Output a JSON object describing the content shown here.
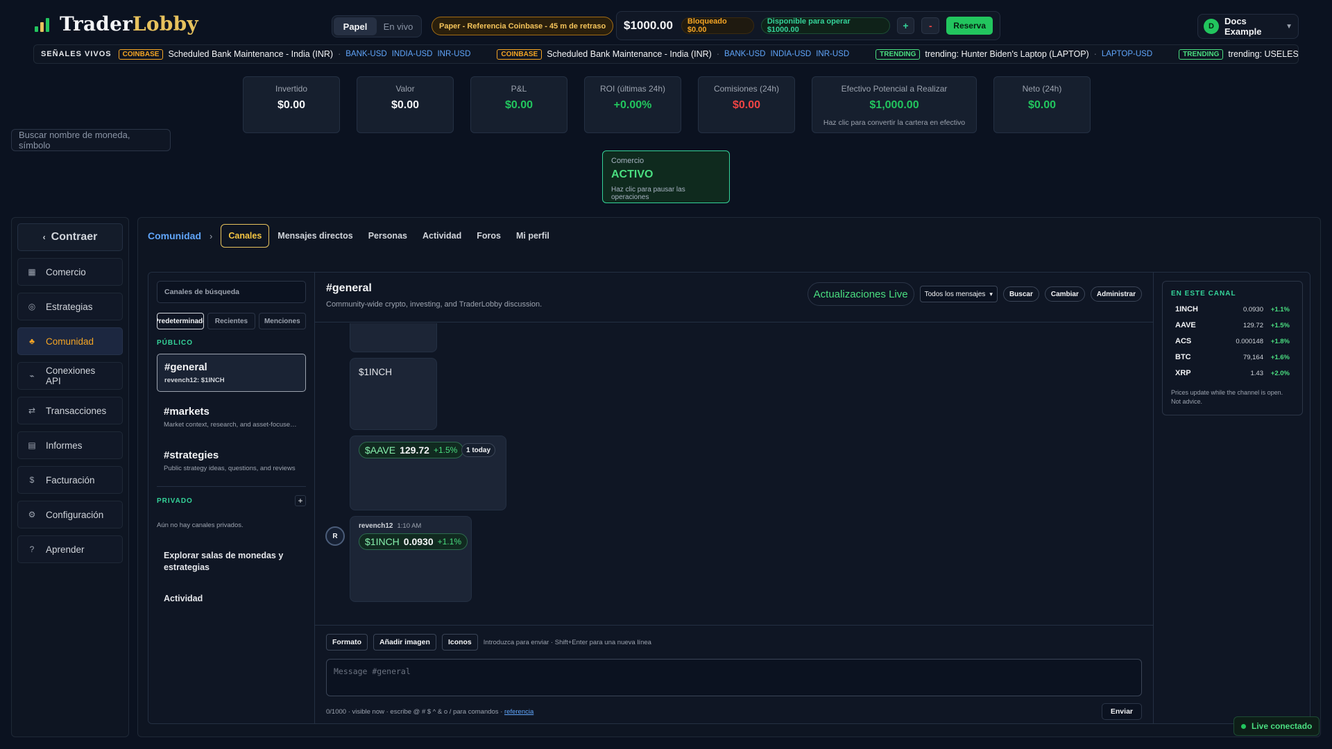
{
  "header": {
    "logo_part1": "Trader",
    "logo_part2": "Lobby",
    "mode_paper": "Papel",
    "mode_live": "En vivo",
    "paper_notice": "Paper - Referencia Coinbase - 45 m de retraso",
    "balance": "$1000.00",
    "locked": "Bloqueado $0.00",
    "available": "Disponible para operar $1000.00",
    "plus_label": "+",
    "minus_label": "-",
    "reserve_label": "Reserva",
    "user_initial": "D",
    "user_name": "Docs Example"
  },
  "ticker": {
    "title": "SEÑALES VIVOS",
    "items": [
      {
        "source": "COINBASE",
        "text": "Scheduled Bank Maintenance - India (INR)",
        "symbols": [
          "BANK-USD",
          "INDIA-USD",
          "INR-USD"
        ]
      },
      {
        "source": "COINBASE",
        "text": "Scheduled Bank Maintenance - India (INR)",
        "symbols": [
          "BANK-USD",
          "INDIA-USD",
          "INR-USD"
        ]
      },
      {
        "source": "TRENDING",
        "text": "trending: Hunter Biden's Laptop (LAPTOP)",
        "symbols": [
          "LAPTOP-USD"
        ]
      },
      {
        "source": "TRENDING",
        "text": "trending: USELESS STONK (STON",
        "symbols": []
      }
    ]
  },
  "stats": [
    {
      "label": "Invertido",
      "value": "$0.00",
      "color": "#f3f4f6"
    },
    {
      "label": "Valor",
      "value": "$0.00",
      "color": "#f3f4f6"
    },
    {
      "label": "P&L",
      "value": "$0.00",
      "color": "#22c55e"
    },
    {
      "label": "ROI (últimas 24h)",
      "value": "+0.00%",
      "color": "#22c55e"
    },
    {
      "label": "Comisiones (24h)",
      "value": "$0.00",
      "color": "#ef4444"
    },
    {
      "label": "Efectivo Potencial a Realizar",
      "value": "$1,000.00",
      "color": "#22c55e",
      "sub": "Haz clic para convertir la cartera en efectivo"
    },
    {
      "label": "Neto (24h)",
      "value": "$0.00",
      "color": "#22c55e"
    }
  ],
  "coin_search": {
    "placeholder": "Buscar nombre de moneda, símbolo"
  },
  "trading": {
    "label": "Comercio",
    "status": "ACTIVO",
    "sub": "Haz clic para pausar las operaciones"
  },
  "sidebar": {
    "collapse_label": "Contraer",
    "items": [
      {
        "label": "Comercio",
        "icon": "grid-icon",
        "glyph": "▦"
      },
      {
        "label": "Estrategias",
        "icon": "target-icon",
        "glyph": "◎"
      },
      {
        "label": "Comunidad",
        "icon": "community-icon",
        "glyph": "♣",
        "active": true
      },
      {
        "label": "Conexiones API",
        "icon": "link-icon",
        "glyph": "⌁"
      },
      {
        "label": "Transacciones",
        "icon": "swap-icon",
        "glyph": "⇄"
      },
      {
        "label": "Informes",
        "icon": "report-icon",
        "glyph": "▤"
      },
      {
        "label": "Facturación",
        "icon": "dollar-icon",
        "glyph": "$"
      },
      {
        "label": "Configuración",
        "icon": "gear-icon",
        "glyph": "⚙"
      },
      {
        "label": "Aprender",
        "icon": "help-icon",
        "glyph": "?"
      }
    ]
  },
  "community": {
    "crumb": "Comunidad",
    "tabs": [
      {
        "label": "Canales",
        "active": true
      },
      {
        "label": "Mensajes directos"
      },
      {
        "label": "Personas"
      },
      {
        "label": "Actividad"
      },
      {
        "label": "Foros"
      },
      {
        "label": "Mi perfil"
      }
    ]
  },
  "channels": {
    "search_placeholder": "Canales de búsqueda",
    "filter_tabs": [
      "Predeterminado",
      "Recientes",
      "Menciones"
    ],
    "public_label": "PÚBLICO",
    "public": [
      {
        "name": "#general",
        "desc": "revench12: $1INCH",
        "active": true
      },
      {
        "name": "#markets",
        "desc": "Market context, research, and asset-focused discussion"
      },
      {
        "name": "#strategies",
        "desc": "Public strategy ideas, questions, and reviews"
      }
    ],
    "private_label": "PRIVADO",
    "add_label": "+",
    "private_empty": "Aún no hay canales privados.",
    "explore_label": "Explorar salas de monedas y estrategias",
    "activity_label": "Actividad"
  },
  "chat": {
    "title": "#general",
    "desc": "Community-wide crypto, investing, and TraderLobby discussion.",
    "live_updates": "Actualizaciones Live",
    "filter_value": "Todos los mensajes",
    "search_label": "Buscar",
    "switch_label": "Cambiar",
    "admin_label": "Administrar",
    "messages": {
      "text_msg": "$1INCH",
      "aave": {
        "sym": "$AAVE",
        "price": "129.72",
        "chg": "+1.5%",
        "badge": "1 today"
      },
      "last": {
        "avatar": "R",
        "author": "revench12",
        "time": "1:10 AM",
        "sym": "$1INCH",
        "price": "0.0930",
        "chg": "+1.1%"
      }
    }
  },
  "composer": {
    "format_label": "Formato",
    "image_label": "Añadir imagen",
    "icons_label": "Iconos",
    "hint": "Introduzca para enviar · Shift+Enter para una nueva línea",
    "placeholder": "Message #general",
    "footer": "0/1000 · visible now · escribe @ # $ ^ & o / para comandos ·",
    "footer_link": "referencia",
    "send_label": "Enviar"
  },
  "in_channel": {
    "title": "EN ESTE CANAL",
    "rows": [
      {
        "sym": "1INCH",
        "price": "0.0930",
        "chg": "+1.1%"
      },
      {
        "sym": "AAVE",
        "price": "129.72",
        "chg": "+1.5%"
      },
      {
        "sym": "ACS",
        "price": "0.000148",
        "chg": "+1.8%"
      },
      {
        "sym": "BTC",
        "price": "79,164",
        "chg": "+1.6%"
      },
      {
        "sym": "XRP",
        "price": "1.43",
        "chg": "+2.0%"
      }
    ],
    "note": "Prices update while the channel is open. Not advice."
  },
  "status": {
    "live": "Live conectado"
  }
}
